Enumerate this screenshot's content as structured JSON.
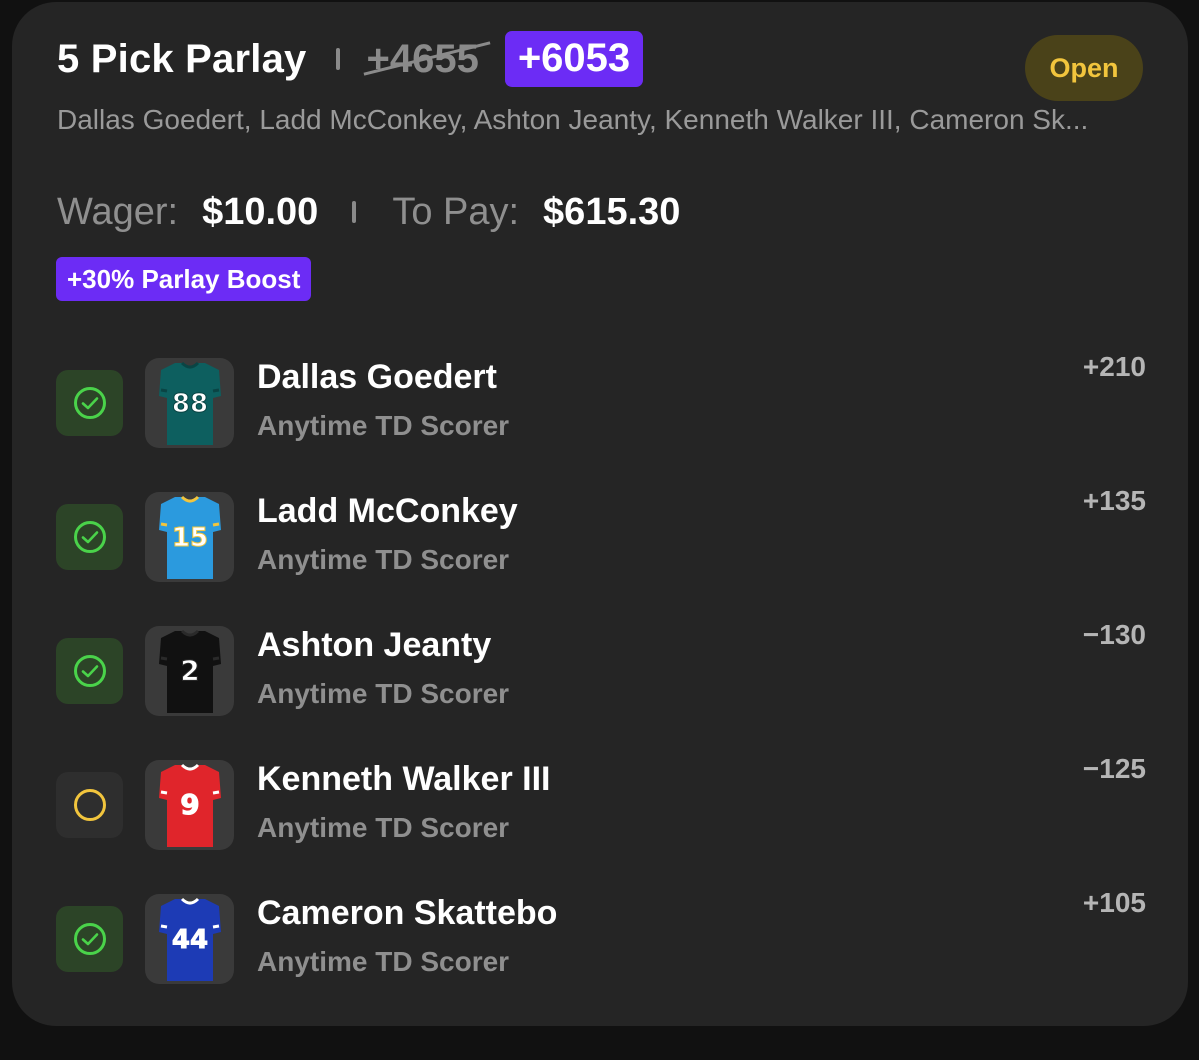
{
  "header": {
    "title": "5 Pick Parlay",
    "original_odds": "+4655",
    "boosted_odds": "+6053",
    "status": "Open",
    "players_summary": "Dallas Goedert, Ladd McConkey, Ashton Jeanty, Kenneth Walker III, Cameron Sk..."
  },
  "bet": {
    "wager_label": "Wager:",
    "wager_value": "$10.00",
    "payout_label": "To Pay:",
    "payout_value": "$615.30",
    "boost_label": "+30% Parlay Boost"
  },
  "picks": [
    {
      "name": "Dallas Goedert",
      "market": "Anytime TD Scorer",
      "odds": "+210",
      "status": "won",
      "jersey_number": "88",
      "jersey_color": "#0d5f5f",
      "jersey_trim": "#0a4444"
    },
    {
      "name": "Ladd McConkey",
      "market": "Anytime TD Scorer",
      "odds": "+135",
      "status": "won",
      "jersey_number": "15",
      "jersey_color": "#2b9ade",
      "jersey_trim": "#f2c53d"
    },
    {
      "name": "Ashton Jeanty",
      "market": "Anytime TD Scorer",
      "odds": "−130",
      "status": "won",
      "jersey_number": "2",
      "jersey_color": "#111111",
      "jersey_trim": "#2a2a2a"
    },
    {
      "name": "Kenneth Walker III",
      "market": "Anytime TD Scorer",
      "odds": "−125",
      "status": "pending",
      "jersey_number": "9",
      "jersey_color": "#e0252b",
      "jersey_trim": "#ffffff"
    },
    {
      "name": "Cameron Skattebo",
      "market": "Anytime TD Scorer",
      "odds": "+105",
      "status": "won",
      "jersey_number": "44",
      "jersey_color": "#1d3bb5",
      "jersey_trim": "#ffffff"
    }
  ],
  "colors": {
    "accent_purple": "#6c2cf5",
    "won_green": "#4ad34a",
    "pending_yellow": "#f2c53d"
  },
  "icons": {
    "won": "check-circle-icon",
    "pending": "pending-circle-icon"
  }
}
